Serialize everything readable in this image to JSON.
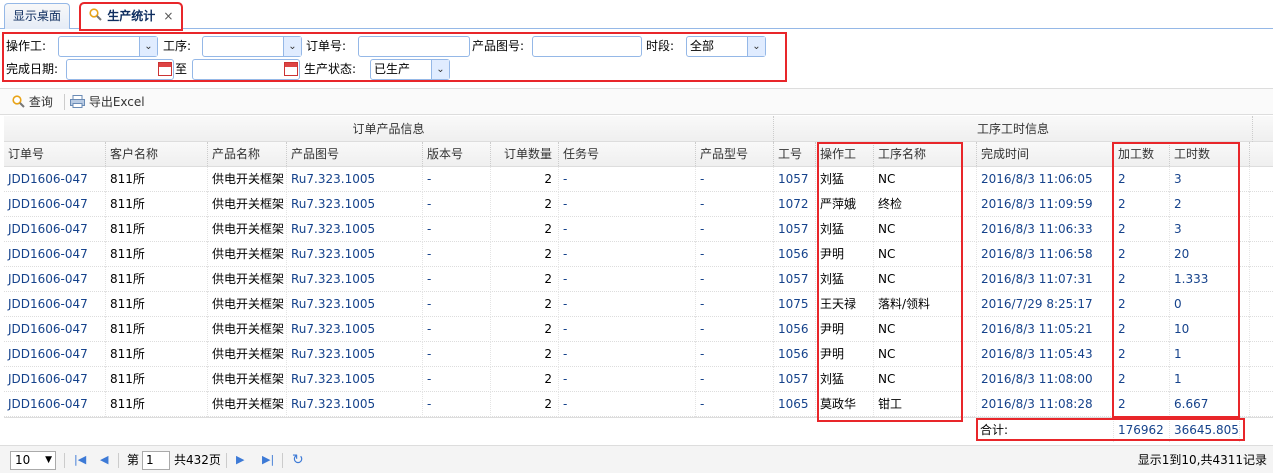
{
  "tabs": [
    {
      "label": "显示桌面"
    },
    {
      "label": "生产统计",
      "close": "×"
    }
  ],
  "filters": {
    "operator_label": "操作工:",
    "process_label": "工序:",
    "order_label": "订单号:",
    "drawing_label": "产品图号:",
    "period_label": "时段:",
    "period_value": "全部",
    "date_label": "完成日期:",
    "to_label": "至",
    "status_label": "生产状态:",
    "status_value": "已生产"
  },
  "toolbar": {
    "query_label": "查询",
    "export_label": "导出Excel"
  },
  "grid": {
    "group_left": "订单产品信息",
    "group_right": "工序工时信息",
    "columns": [
      "订单号",
      "客户名称",
      "产品名称",
      "产品图号",
      "版本号",
      "订单数量",
      "任务号",
      "产品型号",
      "工号",
      "操作工",
      "工序名称",
      "完成时间",
      "加工数",
      "工时数"
    ],
    "rows": [
      [
        "JDD1606-047",
        "811所",
        "供电开关框架",
        "Ru7.323.1005",
        "-",
        "2",
        "-",
        "-",
        "1057",
        "刘猛",
        "NC",
        "2016/8/3 11:06:05",
        "2",
        "3"
      ],
      [
        "JDD1606-047",
        "811所",
        "供电开关框架",
        "Ru7.323.1005",
        "-",
        "2",
        "-",
        "-",
        "1072",
        "严萍娥",
        "终检",
        "2016/8/3 11:09:59",
        "2",
        "2"
      ],
      [
        "JDD1606-047",
        "811所",
        "供电开关框架",
        "Ru7.323.1005",
        "-",
        "2",
        "-",
        "-",
        "1057",
        "刘猛",
        "NC",
        "2016/8/3 11:06:33",
        "2",
        "3"
      ],
      [
        "JDD1606-047",
        "811所",
        "供电开关框架",
        "Ru7.323.1005",
        "-",
        "2",
        "-",
        "-",
        "1056",
        "尹明",
        "NC",
        "2016/8/3 11:06:58",
        "2",
        "20"
      ],
      [
        "JDD1606-047",
        "811所",
        "供电开关框架",
        "Ru7.323.1005",
        "-",
        "2",
        "-",
        "-",
        "1057",
        "刘猛",
        "NC",
        "2016/8/3 11:07:31",
        "2",
        "1.333"
      ],
      [
        "JDD1606-047",
        "811所",
        "供电开关框架",
        "Ru7.323.1005",
        "-",
        "2",
        "-",
        "-",
        "1075",
        "王天禄",
        "落料/领料",
        "2016/7/29 8:25:17",
        "2",
        "0"
      ],
      [
        "JDD1606-047",
        "811所",
        "供电开关框架",
        "Ru7.323.1005",
        "-",
        "2",
        "-",
        "-",
        "1056",
        "尹明",
        "NC",
        "2016/8/3 11:05:21",
        "2",
        "10"
      ],
      [
        "JDD1606-047",
        "811所",
        "供电开关框架",
        "Ru7.323.1005",
        "-",
        "2",
        "-",
        "-",
        "1056",
        "尹明",
        "NC",
        "2016/8/3 11:05:43",
        "2",
        "1"
      ],
      [
        "JDD1606-047",
        "811所",
        "供电开关框架",
        "Ru7.323.1005",
        "-",
        "2",
        "-",
        "-",
        "1057",
        "刘猛",
        "NC",
        "2016/8/3 11:08:00",
        "2",
        "1"
      ],
      [
        "JDD1606-047",
        "811所",
        "供电开关框架",
        "Ru7.323.1005",
        "-",
        "2",
        "-",
        "-",
        "1065",
        "莫政华",
        "钳工",
        "2016/8/3 11:08:28",
        "2",
        "6.667"
      ]
    ],
    "footer": {
      "label": "合计:",
      "total_qty": "176962",
      "total_hours": "36645.805"
    }
  },
  "pager": {
    "page_size": "10",
    "page_prefix": "第",
    "page_value": "1",
    "page_total": "共432页",
    "summary": "显示1到10,共4311记录"
  },
  "colors": {
    "highlight": "#e8262a",
    "link_blue": "#15428b",
    "border_blue": "#95b8e7"
  }
}
